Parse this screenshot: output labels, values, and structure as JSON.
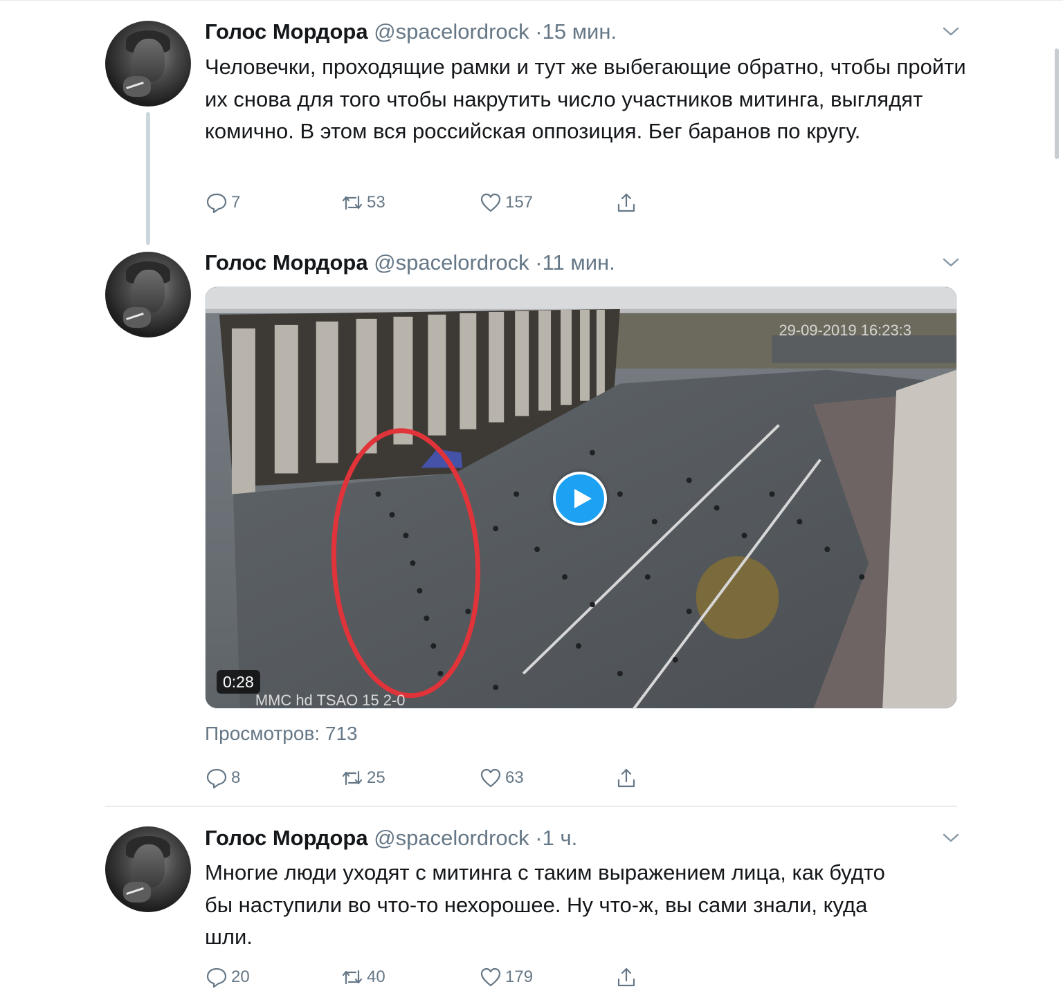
{
  "tweets": [
    {
      "author_name": "Голос Мордора",
      "handle": "@spacelordrock",
      "separator": "·",
      "time": "15 мин.",
      "text": "Человечки, проходящие рамки и тут же выбегающие обратно, чтобы пройти их снова для того чтобы накрутить число участников митинга, выглядят комично. В этом вся российская оппозиция. Бег баранов по кругу.",
      "replies": "7",
      "retweets": "53",
      "likes": "157"
    },
    {
      "author_name": "Голос Мордора",
      "handle": "@spacelordrock",
      "separator": "·",
      "time": "11 мин.",
      "text": "",
      "video": {
        "duration": "0:28",
        "overlay_timestamp": "29-09-2019 16:23:3",
        "overlay_camera": "MMC  hd  TSAO  15  2-0"
      },
      "views": "Просмотров: 713",
      "replies": "8",
      "retweets": "25",
      "likes": "63"
    },
    {
      "author_name": "Голос Мордора",
      "handle": "@spacelordrock",
      "separator": "·",
      "time": "1 ч.",
      "text": "Многие люди уходят с митинга с таким выражением лица, как будто бы наступили во что-то нехорошее. Ну что-ж, вы сами знали, куда шли.",
      "replies": "20",
      "retweets": "40",
      "likes": "179"
    }
  ],
  "colors": {
    "accent": "#1da1f2",
    "secondary_text": "#657786",
    "primary_text": "#14171a",
    "divider": "#e6ecf0"
  },
  "icons": [
    "chevron-down-icon",
    "reply-icon",
    "retweet-icon",
    "like-icon",
    "share-icon",
    "play-icon"
  ]
}
